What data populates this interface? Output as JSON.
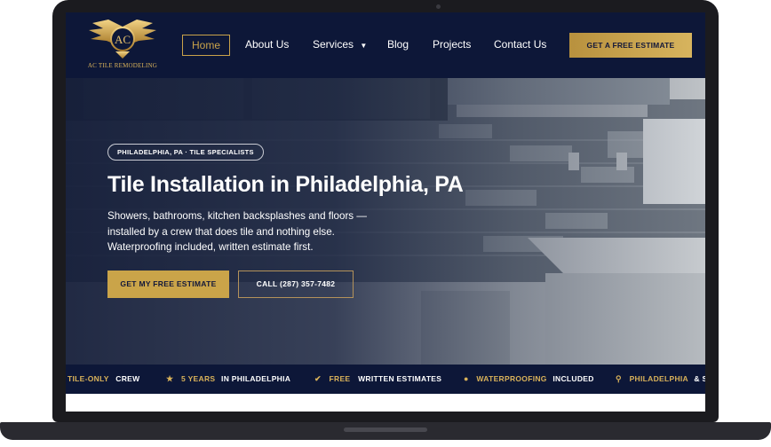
{
  "brand": {
    "logo_text": "AC TILE REMODELING",
    "logo_initials": "AC"
  },
  "nav": {
    "home": "Home",
    "about": "About Us",
    "services": "Services",
    "blog": "Blog",
    "projects": "Projects",
    "contact": "Contact Us"
  },
  "header_cta": "GET A FREE ESTIMATE",
  "hero": {
    "badge": "PHILADELPHIA, PA · TILE SPECIALISTS",
    "title": "Tile Installation in Philadelphia, PA",
    "line1": "Showers, bathrooms, kitchen backsplashes and floors —",
    "line2": "installed by a crew that does tile and nothing else.",
    "line3": "Waterproofing included, written estimate first.",
    "primary_button": "GET MY FREE ESTIMATE",
    "call_button": "CALL (287) 357-7482"
  },
  "ticker": [
    {
      "highlight": "TILE-ONLY",
      "rest": "CREW",
      "icon": ""
    },
    {
      "highlight": "5 YEARS",
      "rest": "IN PHILADELPHIA",
      "icon": "star-icon"
    },
    {
      "highlight": "FREE",
      "rest": "WRITTEN ESTIMATES",
      "icon": "check-circle-icon"
    },
    {
      "highlight": "WATERPROOFING",
      "rest": "INCLUDED",
      "icon": "droplet-icon"
    },
    {
      "highlight": "PHILADELPHIA",
      "rest": "& SU",
      "icon": "map-pin-icon"
    }
  ],
  "colors": {
    "navy": "#0d1738",
    "gold": "#caa449",
    "white": "#ffffff"
  }
}
